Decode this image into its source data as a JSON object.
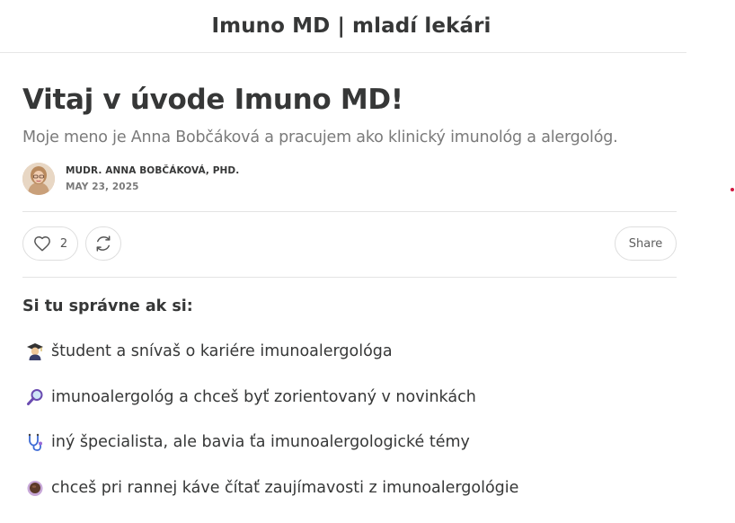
{
  "header": {
    "site_title": "Imuno MD | mladí lekári"
  },
  "post": {
    "title": "Vitaj v úvode Imuno MD!",
    "subtitle": "Moje meno je Anna Bobčáková a pracujem ako klinický imunológ a alergológ.",
    "author": "MUDR. ANNA BOBČÁKOVÁ, PHD.",
    "date": "MAY 23, 2025"
  },
  "actions": {
    "like_count": "2",
    "share_label": "Share"
  },
  "body": {
    "intro": "Si tu správne ak si:",
    "items": [
      {
        "emoji": "student-emoji",
        "text": "študent a snívaš o kariére imunoalergológa"
      },
      {
        "emoji": "magnifying-glass-emoji",
        "text": "imunoalergológ a chceš byť zorientovaný v novinkách"
      },
      {
        "emoji": "stethoscope-emoji",
        "text": "iný špecialista, ale bavia ťa imunoalergologické témy"
      },
      {
        "emoji": "coffee-emoji",
        "text": "chceš pri rannej káve čítať zaujímavosti z imunoalergológie"
      }
    ]
  },
  "colors": {
    "text": "#363737",
    "muted": "#7a7a7a",
    "border": "#e3e3e3",
    "accent_dot": "#d0183f"
  }
}
